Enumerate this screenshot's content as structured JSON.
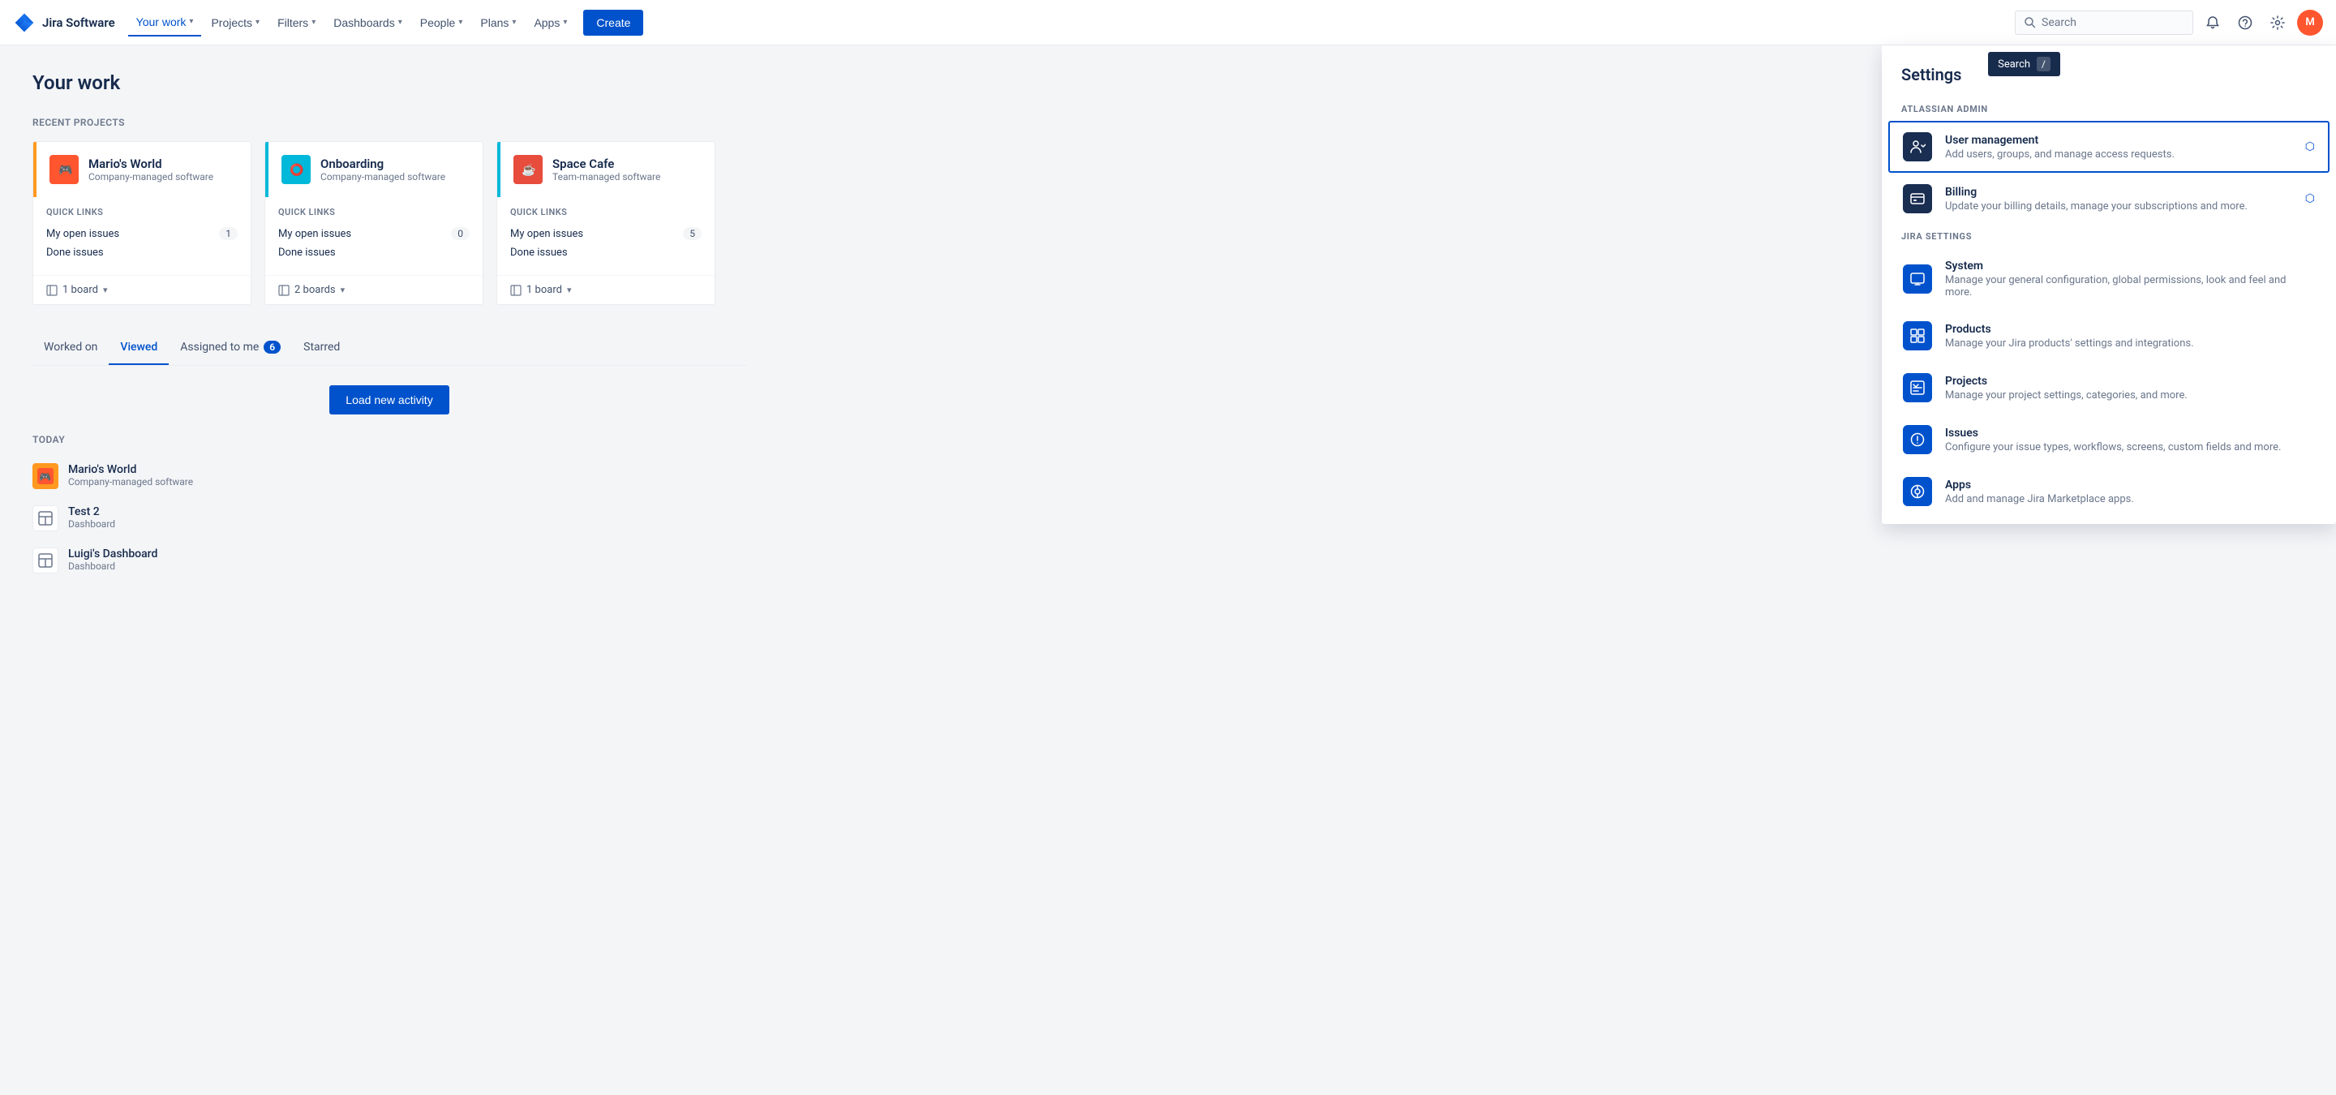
{
  "nav": {
    "logo_text": "Jira Software",
    "items": [
      {
        "label": "Your work",
        "active": true,
        "has_chevron": true
      },
      {
        "label": "Projects",
        "active": false,
        "has_chevron": true
      },
      {
        "label": "Filters",
        "active": false,
        "has_chevron": true
      },
      {
        "label": "Dashboards",
        "active": false,
        "has_chevron": true
      },
      {
        "label": "People",
        "active": false,
        "has_chevron": true
      },
      {
        "label": "Plans",
        "active": false,
        "has_chevron": true
      },
      {
        "label": "Apps",
        "active": false,
        "has_chevron": true
      }
    ],
    "create_label": "Create",
    "search_placeholder": "Search"
  },
  "page": {
    "title": "Your work"
  },
  "recent_projects": {
    "section_title": "Recent projects",
    "projects": [
      {
        "name": "Mario's World",
        "type": "Company-managed software",
        "color": "yellow",
        "icon_bg": "#ff5630",
        "quick_links": [
          {
            "label": "My open issues",
            "count": "1"
          },
          {
            "label": "Done issues",
            "count": null
          }
        ],
        "boards": "1 board"
      },
      {
        "name": "Onboarding",
        "type": "Company-managed software",
        "color": "cyan",
        "icon_bg": "#00b8d9",
        "quick_links": [
          {
            "label": "My open issues",
            "count": "0"
          },
          {
            "label": "Done issues",
            "count": null
          }
        ],
        "boards": "2 boards"
      },
      {
        "name": "Space Cafe",
        "type": "Team-managed software",
        "color": "cyan",
        "icon_bg": "#e74c3c",
        "quick_links": [
          {
            "label": "My open issues",
            "count": "5"
          },
          {
            "label": "Done issues",
            "count": null
          }
        ],
        "boards": "1 board"
      }
    ]
  },
  "tabs": [
    {
      "label": "Worked on",
      "active": false,
      "badge": null
    },
    {
      "label": "Viewed",
      "active": true,
      "badge": null
    },
    {
      "label": "Assigned to me",
      "active": false,
      "badge": "6"
    },
    {
      "label": "Starred",
      "active": false,
      "badge": null
    }
  ],
  "load_activity": {
    "button_label": "Load new activity"
  },
  "today_section": {
    "label": "TODAY",
    "items": [
      {
        "name": "Mario's World",
        "type": "Company-managed software",
        "icon_type": "mario"
      },
      {
        "name": "Test 2",
        "type": "Dashboard",
        "icon_type": "dashboard"
      },
      {
        "name": "Luigi's Dashboard",
        "type": "Dashboard",
        "icon_type": "dashboard"
      }
    ]
  },
  "search_tooltip": {
    "label": "Search",
    "shortcut": "/"
  },
  "settings": {
    "title": "Settings",
    "atlassian_admin_label": "ATLASSIAN ADMIN",
    "jira_settings_label": "JIRA SETTINGS",
    "items_admin": [
      {
        "name": "User management",
        "desc": "Add users, groups, and manage access requests.",
        "highlighted": true,
        "external": true
      },
      {
        "name": "Billing",
        "desc": "Update your billing details, manage your subscriptions and more.",
        "highlighted": false,
        "external": true
      }
    ],
    "items_jira": [
      {
        "name": "System",
        "desc": "Manage your general configuration, global permissions, look and feel and more."
      },
      {
        "name": "Products",
        "desc": "Manage your Jira products' settings and integrations."
      },
      {
        "name": "Projects",
        "desc": "Manage your project settings, categories, and more."
      },
      {
        "name": "Issues",
        "desc": "Configure your issue types, workflows, screens, custom fields and more."
      },
      {
        "name": "Apps",
        "desc": "Add and manage Jira Marketplace apps."
      }
    ]
  }
}
